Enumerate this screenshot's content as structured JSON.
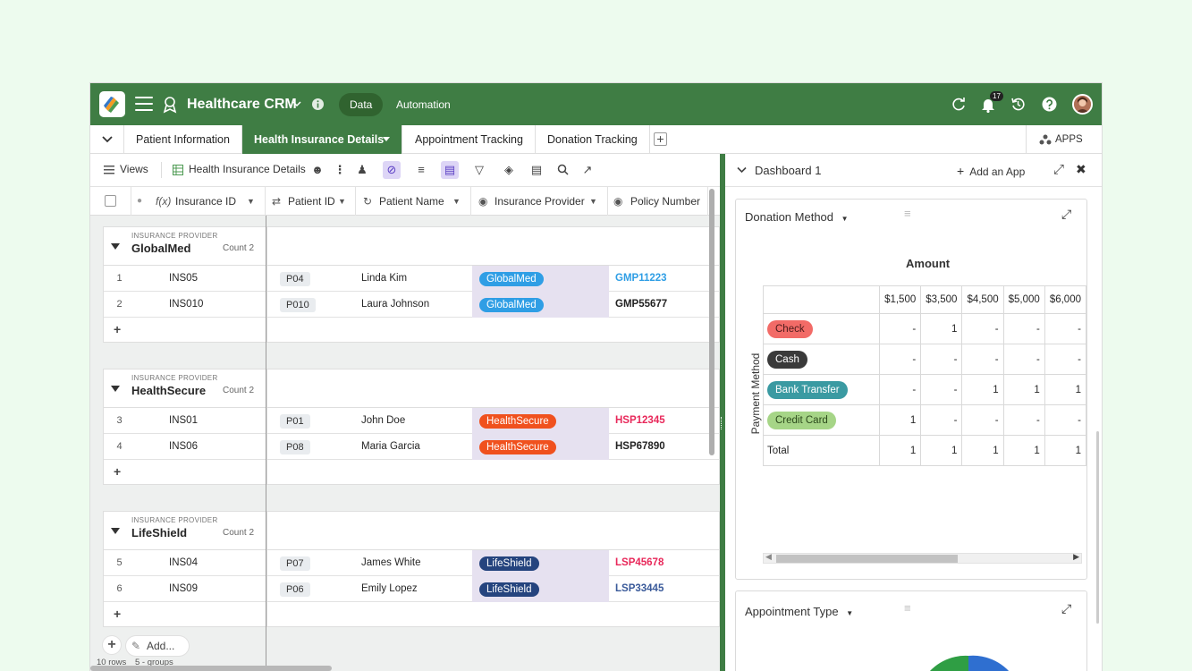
{
  "header": {
    "app_title": "Healthcare CRM",
    "data_label": "Data",
    "automation_label": "Automation",
    "notification_count": "17"
  },
  "tabs": {
    "items": [
      {
        "label": "Patient Information"
      },
      {
        "label": "Health Insurance Details"
      },
      {
        "label": "Appointment Tracking"
      },
      {
        "label": "Donation Tracking"
      }
    ],
    "apps_label": "APPS"
  },
  "toolbar": {
    "views_label": "Views",
    "table_name": "Health Insurance Details"
  },
  "columns": [
    {
      "label": "Insurance ID"
    },
    {
      "label": "Patient ID"
    },
    {
      "label": "Patient Name"
    },
    {
      "label": "Insurance Provider"
    },
    {
      "label": "Policy Number"
    }
  ],
  "groups": [
    {
      "group_label": "INSURANCE PROVIDER",
      "name": "GlobalMed",
      "count": "Count 2",
      "color": "#2f9ee5",
      "rows": [
        {
          "num": "1",
          "insurance_id": "INS05",
          "patient_id": "P04",
          "patient_name": "Linda Kim",
          "provider": "GlobalMed",
          "policy": "GMP11223",
          "policy_color": "#2f9ee5"
        },
        {
          "num": "2",
          "insurance_id": "INS010",
          "patient_id": "P010",
          "patient_name": "Laura Johnson",
          "provider": "GlobalMed",
          "policy": "GMP55677",
          "policy_color": "#222222"
        }
      ]
    },
    {
      "group_label": "INSURANCE PROVIDER",
      "name": "HealthSecure",
      "count": "Count 2",
      "color": "#f0511e",
      "rows": [
        {
          "num": "3",
          "insurance_id": "INS01",
          "patient_id": "P01",
          "patient_name": "John Doe",
          "provider": "HealthSecure",
          "policy": "HSP12345",
          "policy_color": "#e8285a"
        },
        {
          "num": "4",
          "insurance_id": "INS06",
          "patient_id": "P08",
          "patient_name": "Maria Garcia",
          "provider": "HealthSecure",
          "policy": "HSP67890",
          "policy_color": "#222222"
        }
      ]
    },
    {
      "group_label": "INSURANCE PROVIDER",
      "name": "LifeShield",
      "count": "Count 2",
      "color": "#25447e",
      "rows": [
        {
          "num": "5",
          "insurance_id": "INS04",
          "patient_id": "P07",
          "patient_name": "James White",
          "provider": "LifeShield",
          "policy": "LSP45678",
          "policy_color": "#e8285a"
        },
        {
          "num": "6",
          "insurance_id": "INS09",
          "patient_id": "P06",
          "patient_name": "Emily Lopez",
          "provider": "LifeShield",
          "policy": "LSP33445",
          "policy_color": "#3a5a9a"
        }
      ]
    }
  ],
  "footer": {
    "add_label": "Add...",
    "rows_summary": "10 rows",
    "groups_summary": "5 - groups"
  },
  "dashboard": {
    "title": "Dashboard 1",
    "add_app_label": "Add an App",
    "card1_title": "Donation Method",
    "card2_title": "Appointment Type"
  },
  "chart_data": {
    "type": "table",
    "title": "Amount",
    "row_axis_label": "Payment Method",
    "columns": [
      "$1,500",
      "$3,500",
      "$4,500",
      "$5,000",
      "$6,000"
    ],
    "rows": [
      {
        "label": "Check",
        "color": "#f26b67",
        "text_color": "#4a1a1a",
        "values": [
          "-",
          "1",
          "-",
          "-",
          "-"
        ]
      },
      {
        "label": "Cash",
        "color": "#3a3a3a",
        "text_color": "#ffffff",
        "values": [
          "-",
          "-",
          "-",
          "-",
          "-"
        ]
      },
      {
        "label": "Bank Transfer",
        "color": "#3a9aa2",
        "text_color": "#ffffff",
        "values": [
          "-",
          "-",
          "1",
          "1",
          "1"
        ]
      },
      {
        "label": "Credit Card",
        "color": "#a6d587",
        "text_color": "#2c4a1c",
        "values": [
          "1",
          "-",
          "-",
          "-",
          "-"
        ]
      }
    ],
    "total_label": "Total",
    "totals": [
      "1",
      "1",
      "1",
      "1",
      "1"
    ]
  }
}
